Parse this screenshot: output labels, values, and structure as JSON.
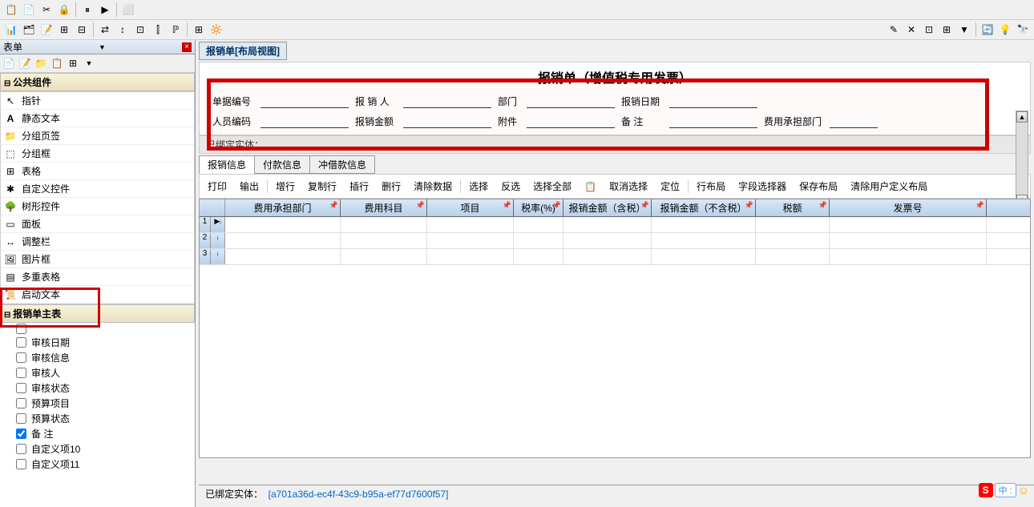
{
  "toolbar": {
    "icons": [
      "paste",
      "copy",
      "cut",
      "lock",
      "pause",
      "play",
      "stop",
      "chart",
      "grid",
      "script",
      "report",
      "bulb",
      "pencil",
      "xmark",
      "box",
      "layers",
      "funnel",
      "refresh",
      "lightbulb",
      "binoculars"
    ]
  },
  "leftPanel": {
    "title": "表单",
    "sections": {
      "public": {
        "title": "公共组件",
        "items": [
          {
            "icon": "pointer",
            "label": "指针"
          },
          {
            "icon": "text",
            "label": "静态文本"
          },
          {
            "icon": "folder",
            "label": "分组页签"
          },
          {
            "icon": "box",
            "label": "分组框"
          },
          {
            "icon": "table",
            "label": "表格"
          },
          {
            "icon": "custom",
            "label": "自定义控件"
          },
          {
            "icon": "tree",
            "label": "树形控件"
          },
          {
            "icon": "panel",
            "label": "面板"
          },
          {
            "icon": "resize",
            "label": "调整栏"
          },
          {
            "icon": "image",
            "label": "图片框"
          },
          {
            "icon": "multigrid",
            "label": "多重表格"
          },
          {
            "icon": "script",
            "label": "启动文本"
          }
        ]
      },
      "main": {
        "title": "报销单主表",
        "items": [
          {
            "checked": false,
            "label": ""
          },
          {
            "checked": false,
            "label": "审核日期"
          },
          {
            "checked": false,
            "label": "审核信息"
          },
          {
            "checked": false,
            "label": "审核人"
          },
          {
            "checked": false,
            "label": "审核状态"
          },
          {
            "checked": false,
            "label": "预算项目"
          },
          {
            "checked": false,
            "label": "预算状态"
          },
          {
            "checked": true,
            "label": "备  注"
          },
          {
            "checked": false,
            "label": "自定义项10"
          },
          {
            "checked": false,
            "label": "自定义项11"
          }
        ]
      }
    }
  },
  "rightPanel": {
    "tab": "报销单[布局视图]",
    "formTitle": "报销单（增值税专用发票）",
    "fields": {
      "row1": [
        {
          "label": "单据编号"
        },
        {
          "label": "报 销 人"
        },
        {
          "label": "部门"
        },
        {
          "label": "报销日期"
        }
      ],
      "row2": [
        {
          "label": "人员编码"
        },
        {
          "label": "报销金额"
        },
        {
          "label": "附件"
        },
        {
          "label": "备  注"
        },
        {
          "label": "费用承担部门"
        }
      ]
    },
    "boundEntity": "已绑定实体：",
    "subTabs": [
      "报销信息",
      "付款信息",
      "冲借款信息"
    ],
    "gridToolbar": [
      "打印",
      "输出",
      "增行",
      "复制行",
      "插行",
      "删行",
      "清除数据",
      "选择",
      "反选",
      "选择全部",
      "📋",
      "取消选择",
      "定位",
      "行布局",
      "字段选择器",
      "保存布局",
      "清除用户定义布局"
    ],
    "gridCols": [
      {
        "label": "费用承担部门",
        "w": 144
      },
      {
        "label": "费用科目",
        "w": 108
      },
      {
        "label": "项目",
        "w": 108
      },
      {
        "label": "税率(%)",
        "w": 62
      },
      {
        "label": "报销金额（含税）",
        "w": 110
      },
      {
        "label": "报销金额（不含税）",
        "w": 130
      },
      {
        "label": "税额",
        "w": 92
      },
      {
        "label": "发票号",
        "w": 196
      }
    ],
    "gridRowNums": [
      "1",
      "2",
      "3"
    ]
  },
  "statusBar": {
    "prefix": "已绑定实体：",
    "guid": "[a701a36d-ec4f-43c9-b95a-ef77d7600f57]"
  },
  "ime": {
    "s": "S",
    "zh": "中 :",
    "smile": "☺"
  }
}
